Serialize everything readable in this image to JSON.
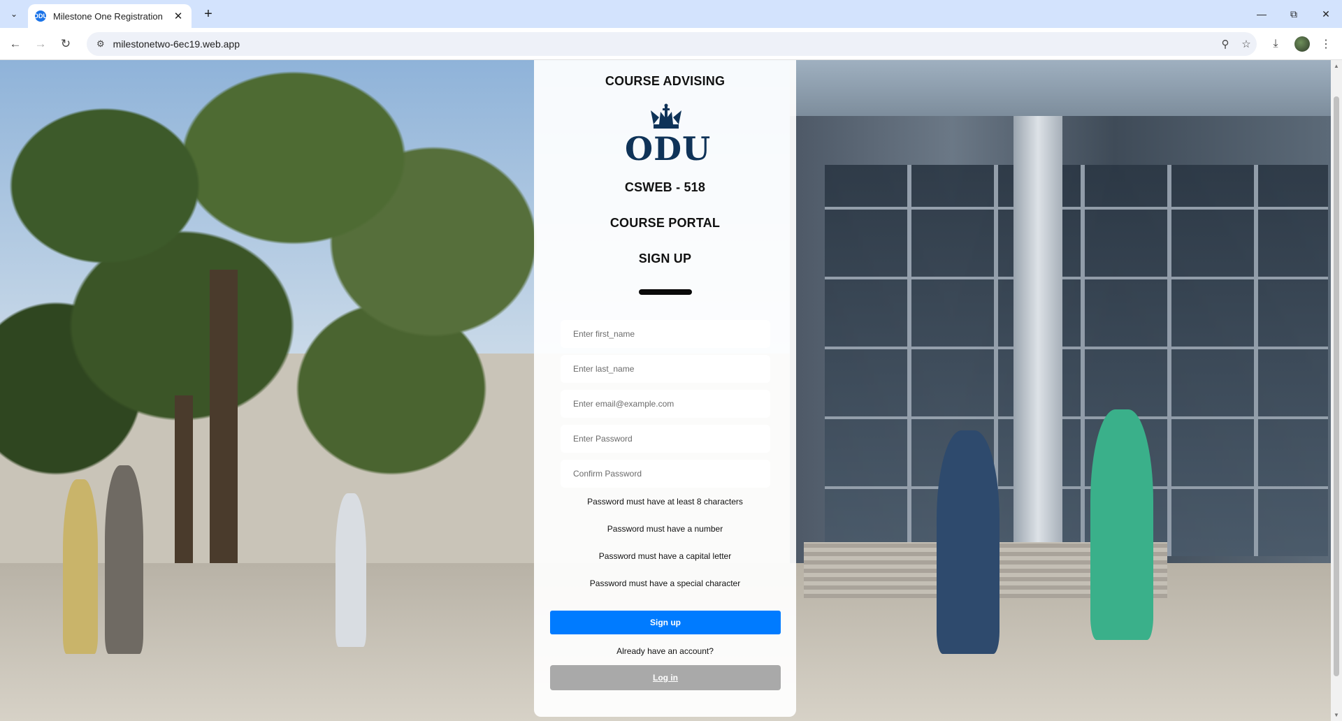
{
  "browser": {
    "tab_title": "Milestone One Registration",
    "tab_favicon": "ODU",
    "new_tab_symbol": "+",
    "url": "milestonetwo-6ec19.web.app"
  },
  "card": {
    "heading": "COURSE ADVISING",
    "logo_text": "ODU",
    "course_code": "CSWEB - 518",
    "portal_title": "COURSE PORTAL",
    "form_title": "SIGN UP"
  },
  "form": {
    "first_name_placeholder": "Enter first_name",
    "last_name_placeholder": "Enter last_name",
    "email_placeholder": "Enter email@example.com",
    "password_placeholder": "Enter Password",
    "confirm_password_placeholder": "Confirm Password"
  },
  "password_rules": [
    "Password must have at least 8 characters",
    "Password must have a number",
    "Password must have a capital letter",
    "Password must have a special character"
  ],
  "actions": {
    "signup_label": "Sign up",
    "have_account_text": "Already have an account?",
    "login_label": "Log in"
  },
  "colors": {
    "primary_button": "#007bff",
    "secondary_button": "#a9a9a9",
    "logo_navy": "#0f3358",
    "tabstrip": "#d3e3fd"
  }
}
